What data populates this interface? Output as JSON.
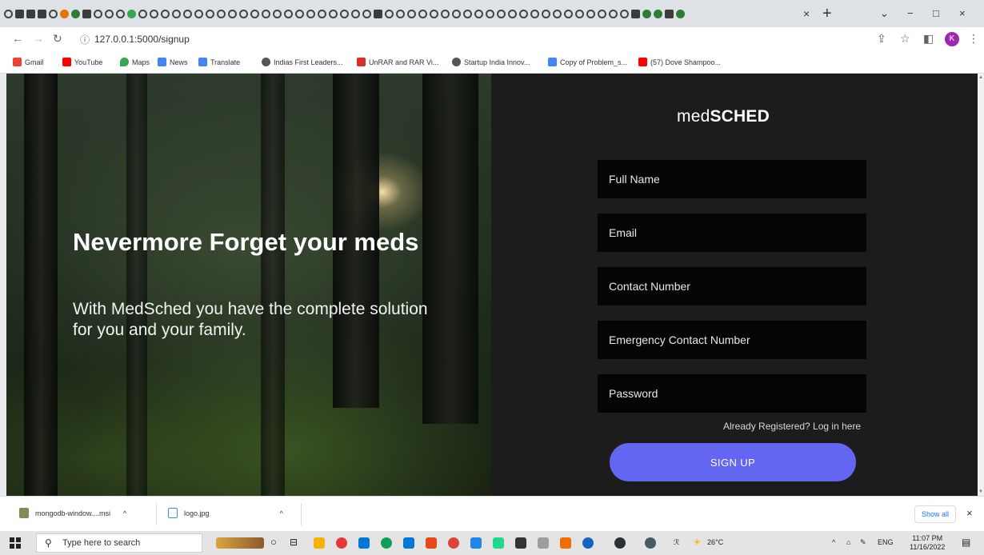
{
  "browser": {
    "tab_close": "×",
    "new_tab": "+",
    "window_controls": {
      "collapse": "⌄",
      "minimize": "−",
      "maximize": "□",
      "close": "×"
    },
    "url": "127.0.0.1:5000/signup",
    "profile_initial": "K"
  },
  "bookmarks": [
    {
      "label": "Gmail",
      "icon": "gmail-icon",
      "color": "#ea4335"
    },
    {
      "label": "YouTube",
      "icon": "youtube-icon",
      "color": "#ff0000"
    },
    {
      "label": "Maps",
      "icon": "maps-icon",
      "color": "#34a853"
    },
    {
      "label": "News",
      "icon": "news-icon",
      "color": "#4285f4"
    },
    {
      "label": "Translate",
      "icon": "translate-icon",
      "color": "#4285f4"
    },
    {
      "label": "Indias First Leaders...",
      "icon": "globe-icon",
      "color": "#555555"
    },
    {
      "label": "UnRAR and RAR Vi...",
      "icon": "bookmark-red-icon",
      "color": "#d93025"
    },
    {
      "label": "Startup India Innov...",
      "icon": "globe-icon",
      "color": "#555555"
    },
    {
      "label": "Copy of Problem_s...",
      "icon": "docs-icon",
      "color": "#4285f4"
    },
    {
      "label": "(57) Dove Shampoo...",
      "icon": "youtube-icon",
      "color": "#ff0000"
    }
  ],
  "hero": {
    "title": "Nevermore Forget your meds",
    "subtitle": "With MedSched you have the complete solution for you and your family."
  },
  "signup_form": {
    "brand_light": "med",
    "brand_bold": "SCHED",
    "full_name_placeholder": "Full Name",
    "email_placeholder": "Email",
    "contact_placeholder": "Contact Number",
    "emergency_placeholder": "Emergency Contact Number",
    "password_placeholder": "Password",
    "login_link": "Already Registered? Log in here",
    "submit_label": "SIGN UP",
    "accent_color": "#6366f1"
  },
  "downloads": {
    "items": [
      {
        "name": "mongodb-window....msi",
        "icon": "installer-icon"
      },
      {
        "name": "logo.jpg",
        "icon": "image-file-icon"
      }
    ],
    "show_all": "Show all",
    "close": "×"
  },
  "taskbar": {
    "search_placeholder": "Type here to search",
    "temperature": "26°C",
    "language": "ENG",
    "time": "11:07 PM",
    "date": "11/16/2022"
  }
}
